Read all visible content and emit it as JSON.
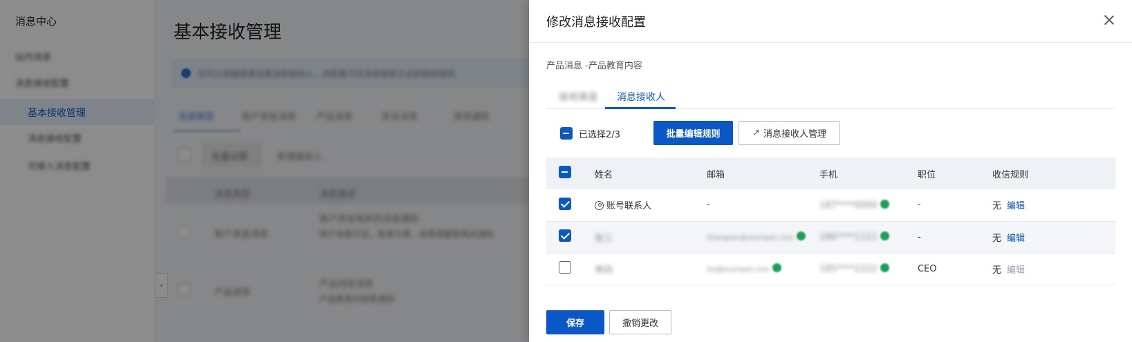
{
  "sidebar": {
    "title": "消息中心",
    "items": [
      {
        "label": "站内消息"
      },
      {
        "label": "消息接收配置"
      },
      {
        "label": "基本接收管理"
      },
      {
        "label": "消息接收配置"
      },
      {
        "label": "可接入消息配置"
      }
    ]
  },
  "main": {
    "page_title": "基本接收管理",
    "notice": "您可以根据需要设置消息接收人，并配置不同消息接收方式和接收规则",
    "tabs": [
      {
        "label": "全部类型"
      },
      {
        "label": "账户资金消息"
      },
      {
        "label": "产品消息"
      },
      {
        "label": "安全消息"
      },
      {
        "label": "其他通知"
      }
    ],
    "batch_btn": "批量设置",
    "add_btn": "新增接收人",
    "table_headers": [
      "消息类型",
      "消息描述"
    ],
    "rows": [
      {
        "type": "账户资金消息",
        "desc_title": "账户资金相关的消息通知",
        "desc": "账户余额不足、账单欠费、续费提醒等相关通知"
      },
      {
        "type": "产品消息",
        "desc_title": "产品动态消息",
        "desc": "产品教育内容等通知"
      }
    ]
  },
  "drawer": {
    "title": "修改消息接收配置",
    "breadcrumb": "产品消息 -产品教育内容",
    "tabs": [
      {
        "label": "接收渠道"
      },
      {
        "label": "消息接收人"
      }
    ],
    "selected_text": "已选择2/3",
    "batch_edit_label": "批量编辑规则",
    "manage_label": "消息接收人管理",
    "columns": {
      "name": "姓名",
      "email": "邮箱",
      "phone": "手机",
      "position": "职位",
      "rule": "收信规则"
    },
    "rows": [
      {
        "name": "账号联系人",
        "email": "-",
        "phone": "187****0000",
        "position": "-",
        "rule": "无",
        "edit": "编辑"
      },
      {
        "name": "张三",
        "email": "zhangsan@example.com",
        "phone": "186****1111",
        "position": "-",
        "rule": "无",
        "edit": "编辑"
      },
      {
        "name": "李四",
        "email": "lisi@example.com",
        "phone": "185****2222",
        "position": "CEO",
        "rule": "无",
        "edit": "编辑"
      }
    ],
    "save_label": "保存",
    "cancel_label": "撤销更改"
  }
}
